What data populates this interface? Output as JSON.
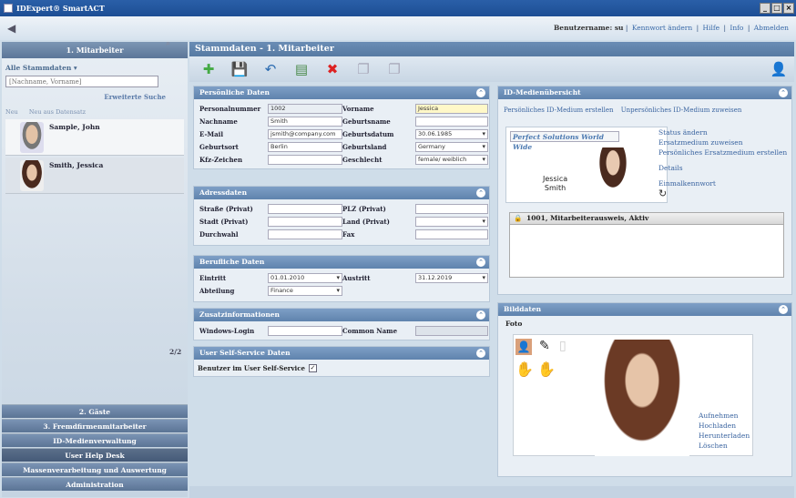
{
  "app": {
    "title": "IDExpert® SmartACT"
  },
  "topbar": {
    "user_label": "Benutzername: su",
    "links": [
      "Kennwort ändern",
      "Hilfe",
      "Info",
      "Abmelden"
    ]
  },
  "sidebar": {
    "header": "1. Mitarbeiter",
    "filter_label": "Alle Stammdaten ▾",
    "search_placeholder": "[Nachname, Vorname]",
    "extended_search": "Erweiterte Suche",
    "new_label": "Neu",
    "new_from_template": "Neu aus Datensatz",
    "people": [
      {
        "name": "Sample, John"
      },
      {
        "name": "Smith, Jessica"
      }
    ],
    "pager": "2/2",
    "nav": [
      "2. Gäste",
      "3. Fremdfirmenmitarbeiter",
      "ID-Medienverwaltung",
      "User Help Desk",
      "Massenverarbeitung und Auswertung",
      "Administration"
    ]
  },
  "main": {
    "title": "Stammdaten - 1. Mitarbeiter",
    "personal": {
      "header": "Persönliche Daten",
      "fields": {
        "personalnummer": {
          "label": "Personalnummer",
          "value": "1002"
        },
        "vorname": {
          "label": "Vorname",
          "value": "Jessica"
        },
        "nachname": {
          "label": "Nachname",
          "value": "Smith"
        },
        "geburtsname": {
          "label": "Geburtsname",
          "value": ""
        },
        "email": {
          "label": "E-Mail",
          "value": "jsmith@company.com"
        },
        "geburtsdatum": {
          "label": "Geburtsdatum",
          "value": "30.06.1985"
        },
        "geburtsort": {
          "label": "Geburtsort",
          "value": "Berlin"
        },
        "geburtsland": {
          "label": "Geburtsland",
          "value": "Germany"
        },
        "kfz": {
          "label": "Kfz-Zeichen",
          "value": ""
        },
        "geschlecht": {
          "label": "Geschlecht",
          "value": "female/ weiblich"
        }
      }
    },
    "address": {
      "header": "Adressdaten",
      "fields": {
        "strasse": {
          "label": "Straße (Privat)",
          "value": ""
        },
        "plz": {
          "label": "PLZ (Privat)",
          "value": ""
        },
        "stadt": {
          "label": "Stadt (Privat)",
          "value": ""
        },
        "land": {
          "label": "Land (Privat)",
          "value": ""
        },
        "durchwahl": {
          "label": "Durchwahl",
          "value": ""
        },
        "fax": {
          "label": "Fax",
          "value": ""
        }
      }
    },
    "job": {
      "header": "Berufliche Daten",
      "fields": {
        "eintritt": {
          "label": "Eintritt",
          "value": "01.01.2010"
        },
        "austritt": {
          "label": "Austritt",
          "value": "31.12.2019"
        },
        "abteilung": {
          "label": "Abteilung",
          "value": "Finance"
        }
      }
    },
    "extra": {
      "header": "Zusatzinformationen",
      "windows_login": "Windows-Login",
      "common_name": "Common Name"
    },
    "selfservice": {
      "header": "User Self-Service Daten",
      "label": "Benutzer im User Self-Service"
    }
  },
  "idmedia": {
    "header": "ID-Medienübersicht",
    "link_personal": "Persönliches ID-Medium erstellen",
    "link_impersonal": "Unpersönliches ID-Medium zuweisen",
    "card_company": "Perfect Solutions World Wide",
    "card_first": "Jessica",
    "card_last": "Smith",
    "actions": [
      "Status ändern",
      "Ersatzmedium zuweisen",
      "Persönliches Ersatzmedium erstellen"
    ],
    "details": "Details",
    "one_time_pw": "Einmalkennwort",
    "medium_row": "1001, Mitarbeiterausweis, Aktiv"
  },
  "photo": {
    "header": "Bilddaten",
    "label": "Foto",
    "actions": [
      "Aufnehmen",
      "Hochladen",
      "Herunterladen",
      "Löschen"
    ]
  }
}
